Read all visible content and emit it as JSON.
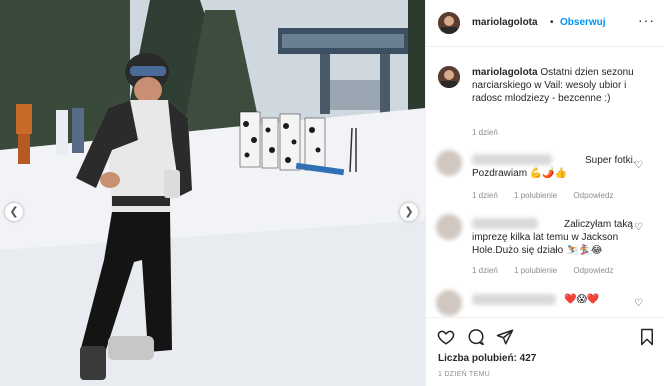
{
  "header": {
    "username": "mariolagolota",
    "separator": "•",
    "follow_label": "Obserwuj",
    "more_label": "···"
  },
  "caption": {
    "username": "mariolagolota",
    "text": "Ostatni dzien sezonu narciarskiego w Vail: wesoly ubior i radosc mlodziezy - bezcenne :)",
    "time": "1 dzień"
  },
  "comments": [
    {
      "text": "Super fotki. Pozdrawiam",
      "emoji": "💪🌶️👍",
      "time": "1 dzień",
      "likes": "1 polubienie",
      "reply": "Odpowiedz"
    },
    {
      "text": "Zaliczyłam taką imprezę kilka lat temu w Jackson Hole.Dużo się działo",
      "emoji": "⛷️🏂😂",
      "time": "1 dzień",
      "likes": "1 polubienie",
      "reply": "Odpowiedz"
    },
    {
      "emoji": "❤️😱❤️"
    }
  ],
  "footer": {
    "likes_label": "Liczba polubień:",
    "likes_count": "427",
    "date": "1 DZIEŃ TEMU"
  },
  "icons": {
    "heart": "heart-icon",
    "comment": "comment-icon",
    "share": "share-icon",
    "bookmark": "bookmark-icon"
  },
  "colors": {
    "link": "#0095f6",
    "muted": "#8e8e8e",
    "text": "#262626"
  }
}
